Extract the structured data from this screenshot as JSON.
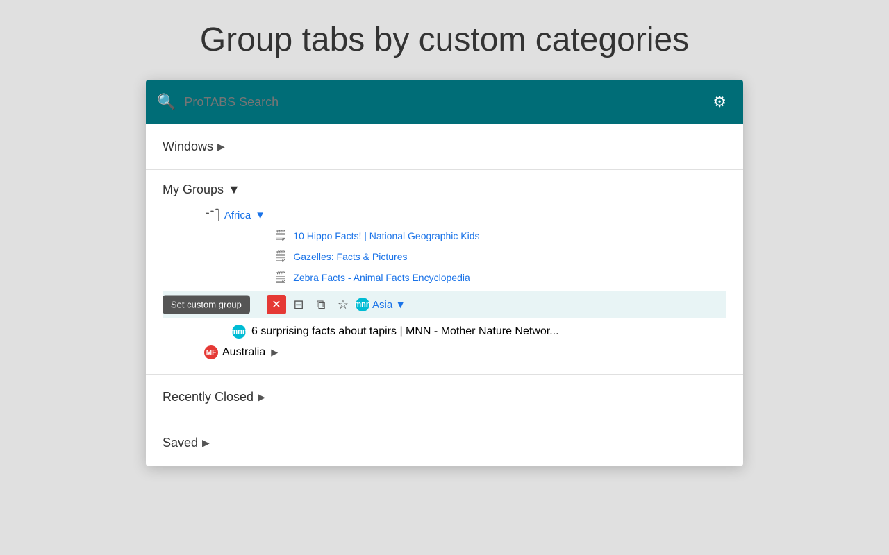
{
  "page": {
    "title": "Group tabs by custom categories"
  },
  "toolbar": {
    "search_placeholder": "ProTABS Search",
    "gear_icon": "⚙"
  },
  "sidebar": {
    "windows_label": "Windows",
    "my_groups_label": "My Groups",
    "recently_closed_label": "Recently Closed",
    "saved_label": "Saved"
  },
  "groups": {
    "africa": {
      "label": "Africa",
      "tabs": [
        "10 Hippo Facts! | National Geographic Kids",
        "Gazelles: Facts & Pictures",
        "Zebra Facts - Animal Facts Encyclopedia"
      ]
    },
    "asia": {
      "label": "Asia",
      "tabs": [
        "6 surprising facts about tapirs | MNN - Mother Nature Networ..."
      ]
    },
    "australia": {
      "label": "Australia"
    }
  },
  "tooltip": {
    "label": "Set custom group"
  },
  "actions": {
    "close": "✕",
    "windows": "⊞",
    "copy": "❐",
    "star": "☆"
  },
  "favicons": {
    "mnn": "mnn",
    "mf": "MF"
  }
}
